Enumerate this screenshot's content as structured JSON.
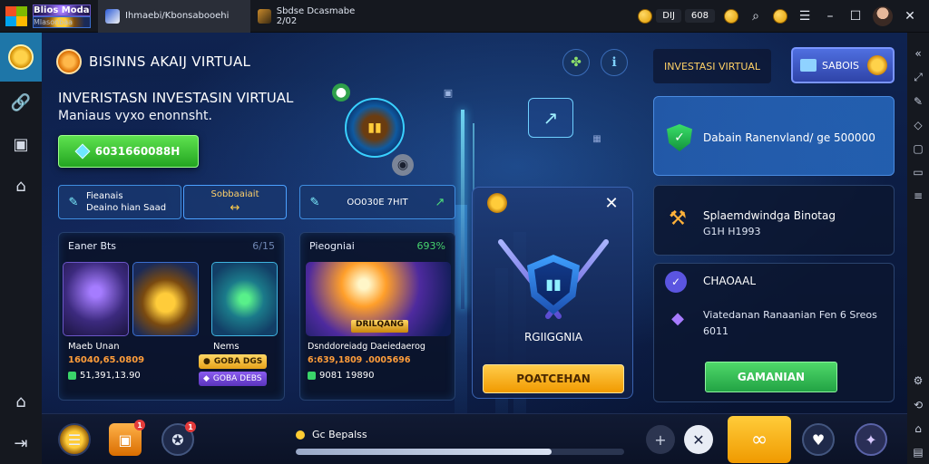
{
  "window": {
    "app_name": "Blios Moda",
    "app_sub": "Mlasonbaa",
    "tabs": [
      {
        "label": "Ihmaebi/Kbonsabooehi"
      },
      {
        "label": "Sbdse Dcasmabe 2/02"
      }
    ],
    "counter_a": "DIJ",
    "counter_b": "608"
  },
  "game": {
    "title": "BISINNS AKAIJ VIRTUAL",
    "headline": "INVERISTASN INVESTASIN VIRTUAL",
    "subline": "Maniaus vyxo enonnsht.",
    "primary_button": "6031660088H",
    "chips": [
      {
        "line1": "Fieanais",
        "line2": "Deaino hian Saad"
      },
      {
        "line1": "Sobbaaiait",
        "line2": "↔"
      },
      {
        "line1": "OO030E 7HIT",
        "line2": ""
      }
    ],
    "left_panel": {
      "title": "Eaner Bts",
      "meta": "6/15",
      "items": [
        {
          "name": "Maeb Unan",
          "value": "16040,65.0809",
          "sub": "51,391,13.90"
        },
        {
          "name": "Nems",
          "value": "GOBA DGS",
          "sub": "GOBA DEBS"
        }
      ]
    },
    "middle_panel": {
      "title": "Pieogniai",
      "meta": "693%",
      "banner": "DRILQANG",
      "caption": "Dsnddoreiadg Daeiedaerog",
      "value": "6:639,1809 .0005696",
      "sub": "9081 19890"
    },
    "shield_card": {
      "caption": "RGIIGGNIA",
      "button": "POATCEHAN"
    },
    "right": {
      "invest_label": "INVESTASI VIRTUAL",
      "saldo_label": "SABOIS",
      "card1": "Dabain Ranenvland/ ge 500000",
      "card2_title": "Splaemdwindga Binotag",
      "card2_sub": "G1H H1993",
      "card3_title": "CHAOAAL",
      "card3_line": "Viatedanan Ranaanian Fen 6 Sreos",
      "card3_sub": "6011",
      "card3_button": "GAMANIAN"
    }
  },
  "bottom": {
    "progress_label": "Gc Bepalss",
    "progress_value": 0.78,
    "badges": [
      "1",
      "1"
    ]
  },
  "colors": {
    "accent_green": "#23a521",
    "accent_orange": "#f19a00",
    "accent_blue": "#1e76a8"
  }
}
